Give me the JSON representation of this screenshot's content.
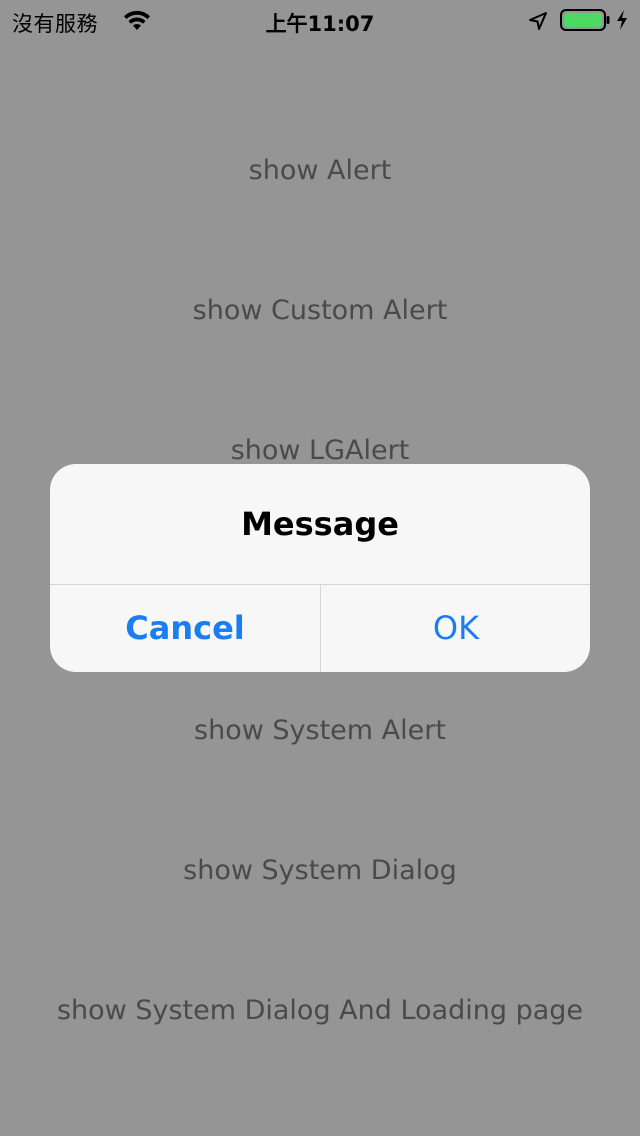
{
  "status_bar": {
    "carrier": "沒有服務",
    "time": "上午11:07",
    "icons": [
      "wifi-icon",
      "location-arrow-icon",
      "battery-icon",
      "charging-bolt-icon"
    ],
    "battery_color": "#4cd964"
  },
  "menu": {
    "items": [
      {
        "label": "show Alert"
      },
      {
        "label": "show Custom Alert"
      },
      {
        "label": "show LGAlert"
      },
      {
        "label": "show System Alert"
      },
      {
        "label": "show System Dialog"
      },
      {
        "label": "show System Dialog And Loading page"
      }
    ]
  },
  "alert": {
    "title": "Message",
    "cancel_label": "Cancel",
    "ok_label": "OK",
    "button_color": "#1a7ef2"
  }
}
